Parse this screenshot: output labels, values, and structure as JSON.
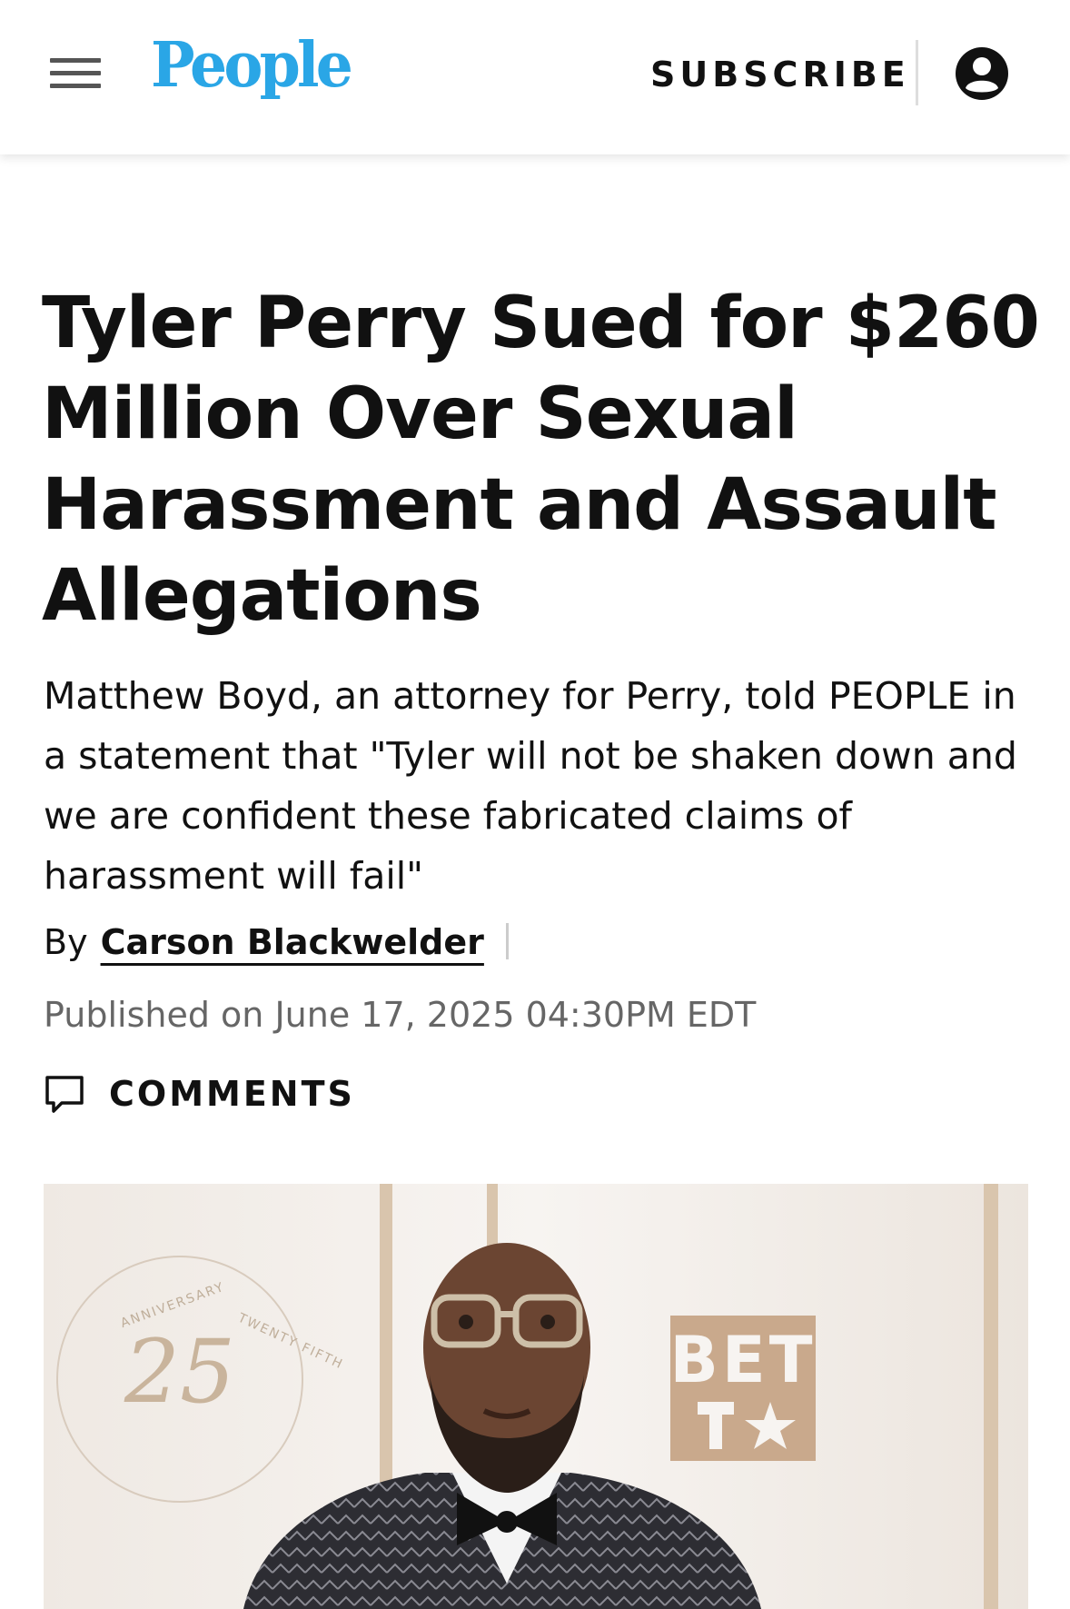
{
  "header": {
    "logo_text": "People",
    "subscribe_label": "SUBSCRIBE",
    "icons": [
      "menu-icon",
      "account-icon"
    ],
    "brand_color": "#2aa6e6"
  },
  "article": {
    "headline": "Tyler Perry Sued for $260 Million Over Sexual Harassment and Assault Allegations",
    "dek": "Matthew Boyd, an attorney for Perry, told PEOPLE in a statement that \"Tyler will not be shaken down and we are confident these fabricated claims of harassment will fail\"",
    "byline_prefix": "By",
    "author": "Carson Blackwelder",
    "published": "Published on June 17, 2025 04:30PM EDT",
    "comments_label": "COMMENTS"
  },
  "photo": {
    "seal_number": "25",
    "seal_text_top": "ANNIVERSARY  TWENTY FIFTH ANNIVERSARY",
    "brand_mark": "BET"
  }
}
